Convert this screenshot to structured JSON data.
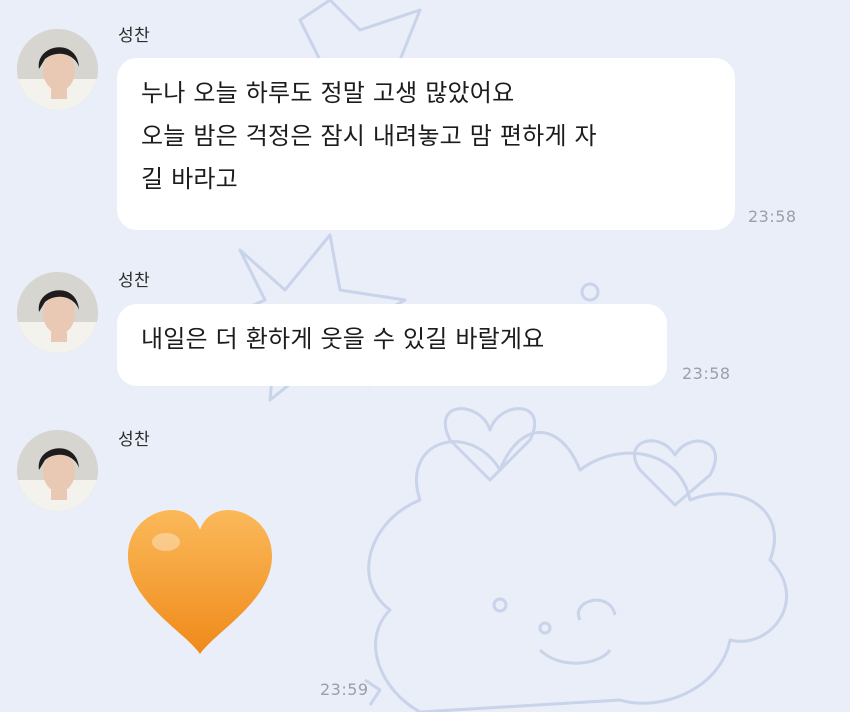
{
  "messages": [
    {
      "sender": "성찬",
      "lines": [
        "누나 오늘 하루도 정말 고생 많았어요",
        "오늘 밤은 걱정은 잠시 내려놓고 맘 편하게 자",
        "길 바라고"
      ],
      "time": "23:58"
    },
    {
      "sender": "성찬",
      "lines": [
        "내일은 더 환하게 웃을 수 있길 바랄게요"
      ],
      "time": "23:58"
    },
    {
      "sender": "성찬",
      "emoji": "orange-heart",
      "time": "23:59"
    }
  ],
  "colors": {
    "background": "#e9eef8",
    "bubble": "#ffffff",
    "heart": "#f59b2b",
    "time_text": "#9aa0ab"
  }
}
